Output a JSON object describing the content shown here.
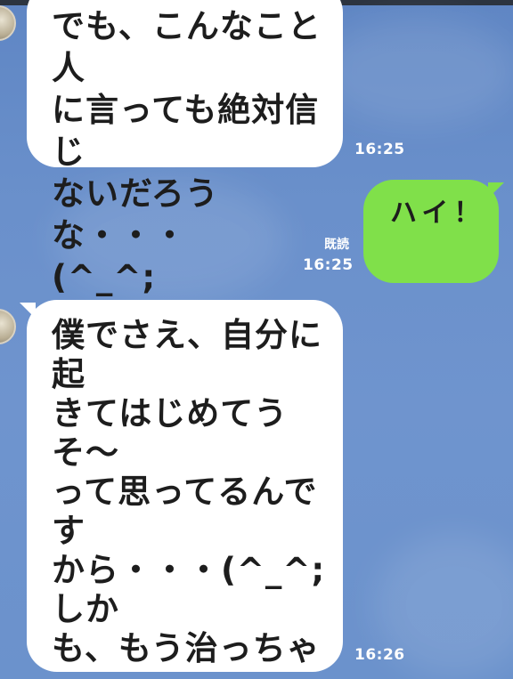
{
  "theme": {
    "background": "#6a90cb",
    "incoming_bubble": "#ffffff",
    "outgoing_bubble": "#80e04a",
    "meta_text": "#ffffff"
  },
  "messages": [
    {
      "direction": "incoming",
      "text": "でも、こんなこと人\nに言っても絶対信じ\nないだろうな・・・\n(^_^;",
      "time": "16:25"
    },
    {
      "direction": "outgoing",
      "text": "ハイ！",
      "read": "既読",
      "time": "16:25"
    },
    {
      "direction": "incoming",
      "text": "僕でさえ、自分に起\nきてはじめてうそ〜\nって思ってるんです\nから・・・(^_^;しか\nも、もう治っちゃっ\nたら、勝手に治った\nのかな・・・とも思\nい始めてるし・・・\n(^_^;",
      "time": "16:26"
    }
  ]
}
